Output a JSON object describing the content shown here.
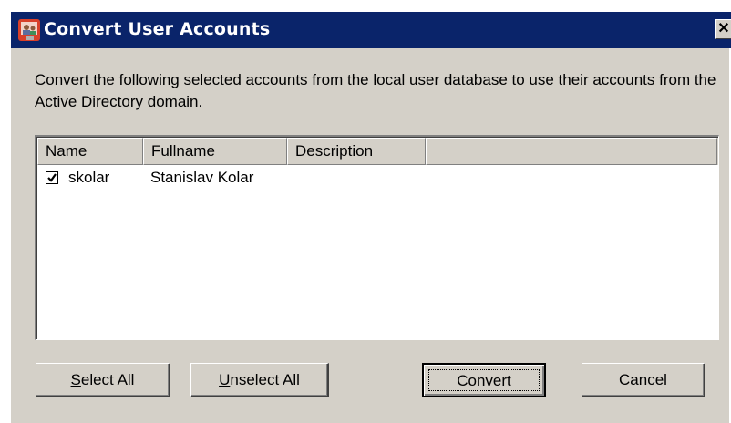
{
  "window": {
    "title": "Convert User Accounts",
    "close_glyph": "✕"
  },
  "description": "Convert the following selected accounts from the local user database to use their accounts from the Active Directory domain.",
  "list": {
    "columns": [
      "Name",
      "Fullname",
      "Description",
      ""
    ],
    "rows": [
      {
        "checked": true,
        "name": "skolar",
        "fullname": "Stanislav Kolar",
        "description": ""
      }
    ]
  },
  "buttons": {
    "select_all": {
      "accel": "S",
      "rest": "elect All"
    },
    "unselect_all": {
      "accel": "U",
      "rest": "nselect All"
    },
    "convert": "Convert",
    "cancel": "Cancel"
  },
  "colors": {
    "titlebar": "#0a246a",
    "dialog_face": "#d4d0c8"
  },
  "icons": {
    "app": "user-accounts-icon",
    "close": "close-icon",
    "checkbox": "checkbox-checked-icon"
  }
}
